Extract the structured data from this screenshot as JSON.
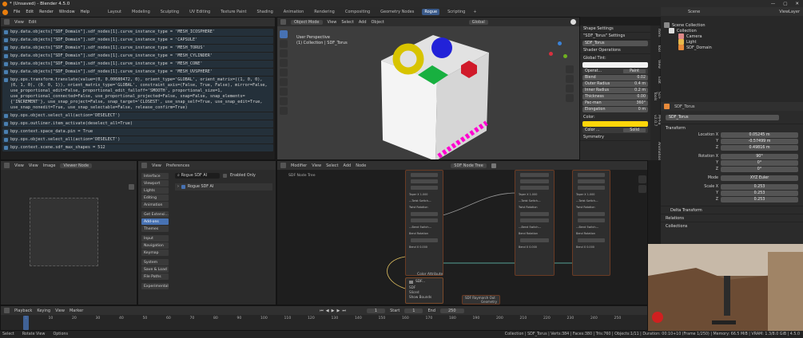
{
  "window": {
    "title": "* (Unsaved) - Blender 4.5.0",
    "controls": [
      "—",
      "▢",
      "✕"
    ]
  },
  "menu": {
    "items": [
      "File",
      "Edit",
      "Render",
      "Window",
      "Help"
    ]
  },
  "workspaces": {
    "tabs": [
      "Layout",
      "Modeling",
      "Sculpting",
      "UV Editing",
      "Texture Paint",
      "Shading",
      "Animation",
      "Rendering",
      "Compositing",
      "Geometry Nodes",
      "Rogue",
      "Scripting"
    ],
    "active": "Rogue",
    "scene": "Scene",
    "view_layer": "ViewLayer"
  },
  "console": {
    "header": [
      "View",
      "Edit"
    ],
    "lines": [
      "bpy.data.objects[\"SDF_Domain\"].sdf_nodes[1].curve_instance_type = 'MESH_ICOSPHERE'",
      "bpy.data.objects[\"SDF_Domain\"].sdf_nodes[1].curve_instance_type = 'CAPSULE'",
      "bpy.data.objects[\"SDF_Domain\"].sdf_nodes[1].curve_instance_type = 'MESH_TORUS'",
      "bpy.data.objects[\"SDF_Domain\"].sdf_nodes[1].curve_instance_type = 'MESH_CYLINDER'",
      "bpy.data.objects[\"SDF_Domain\"].sdf_nodes[1].curve_instance_type = 'MESH_CONE'",
      "bpy.data.objects[\"SDF_Domain\"].sdf_nodes[1].curve_instance_type = 'MESH_UVSPHERE'",
      "bpy.ops.transform.translate(value=(0, 0.00680472, 0), orient_type='GLOBAL', orient_matrix=((1, 0, 0), (0, 1, 0), (0, 0, 1)), orient_matrix_type='GLOBAL', constraint_axis=(False, True, False), mirror=False, use_proportional_edit=False, proportional_edit_falloff='SMOOTH', proportional_size=1, use_proportional_connected=False, use_proportional_projected=False, snap=False, snap_elements={'INCREMENT'}, use_snap_project=False, snap_target='CLOSEST', use_snap_self=True, use_snap_edit=True, use_snap_nonedit=True, use_snap_selectable=False, release_confirm=True)",
      "bpy.ops.object.select_all(action='DESELECT')",
      "bpy.ops.outliner.item_activate(deselect_all=True)",
      "bpy.context.space_data.pin = True",
      "bpy.ops.object.select_all(action='DESELECT')",
      "bpy.context.scene.sdf_max_shapes = 512"
    ]
  },
  "viewport": {
    "mode": "Object Mode",
    "menu": [
      "View",
      "Select",
      "Add",
      "Object"
    ],
    "orientation": "Global",
    "info_line1": "User Perspective",
    "info_line2": "(1) Collection | SDF_Torus",
    "options": "Options",
    "colors": {
      "yellow": "#d8c400",
      "blue": "#2222d8",
      "red": "#d01a2a",
      "green": "#18b040",
      "magenta": "#ff00d0"
    }
  },
  "npanel": {
    "title": "Shape Settings",
    "object": "\"SDF_Torus\" Settings",
    "name": "SDF_Torus",
    "ops_title": "Shader Operations",
    "global_tint": "Global Tint:",
    "operation_label": "Operat...",
    "operation": "Paint",
    "rows": [
      {
        "label": "Blend",
        "value": "0.02"
      },
      {
        "label": "Outer Radius",
        "value": "0.4 m"
      },
      {
        "label": "Inner Radius",
        "value": "0.2 m"
      },
      {
        "label": "Thickness",
        "value": "0.00"
      },
      {
        "label": "Pac-man",
        "value": "360°"
      },
      {
        "label": "Elongation",
        "value": "0 m"
      }
    ],
    "color_label": "Color:",
    "color": "#ffd60a",
    "color_mode_label": "Color ...",
    "color_mode": "Solid",
    "symmetry": "Symmetry"
  },
  "sidetabs": [
    "Item",
    "Tool",
    "View",
    "Edit",
    "SDF Tools",
    "MPFB v2.0.7",
    "Animation"
  ],
  "outliner": {
    "header": "Scene Collection",
    "items": [
      {
        "name": "Collection",
        "level": 1
      },
      {
        "name": "Camera",
        "level": 2
      },
      {
        "name": "Light",
        "level": 2
      },
      {
        "name": "SDF_Domain",
        "level": 2
      }
    ]
  },
  "properties": {
    "object": "SDF_Torus",
    "object_field": "SDF_Torus",
    "transform": "Transform",
    "location_label": "Location X",
    "location": [
      "0.05245 m",
      "-0.57499 m",
      "0.49816 m"
    ],
    "rotation_label": "Rotation X",
    "rotation": [
      "90°",
      "0°",
      "0°"
    ],
    "mode_label": "Mode",
    "mode": "XYZ Euler",
    "scale_label": "Scale X",
    "scale": [
      "0.253",
      "0.253",
      "0.253"
    ],
    "axes": [
      "X",
      "Y",
      "Z"
    ],
    "delta": "Delta Transform",
    "relations": "Relations",
    "collections": "Collections"
  },
  "image_editor": {
    "menu": [
      "View",
      "View",
      "Image"
    ],
    "name": "Viewer Node"
  },
  "prefs": {
    "menu": [
      "View",
      "Preferences"
    ],
    "addon": "Rogue SDF AI",
    "enabled_only": "Enabled Only",
    "addon_item": "Rogue SDF AI",
    "nav": [
      "Interface",
      "Viewport",
      "Lights",
      "Editing",
      "Animation",
      "Get Extensi...",
      "Add-ons",
      "Themes",
      "Input",
      "Navigation",
      "Keymap",
      "System",
      "Save & Load",
      "File Paths",
      "Experimental"
    ],
    "active": "Add-ons"
  },
  "node_editor": {
    "menu": [
      "Modifier",
      "View",
      "Select",
      "Add",
      "Node"
    ],
    "tree": "SDF Node Tree",
    "tree_label": "SDF Node Tree",
    "labels": {
      "taper": "Taper X 1.000",
      "twist_switch": "---Twist Switch---",
      "twist_rot": "Twist Rotation",
      "bend_switch": "---Bend Switch---",
      "bend_rot": "Bend Rotation",
      "bend": "Bend X 0.000"
    },
    "color_attr": "Color Attribute",
    "sdf_node": "SDF...",
    "sdf_socket": "SDF",
    "sliced": "Sliced",
    "show_bounds": "Show Bounds",
    "mode": "Solid",
    "raymarch": "SDF Raymarch Out",
    "geometry": "Geometry"
  },
  "timeline": {
    "menu": [
      "Playback",
      "Keying",
      "View",
      "Marker"
    ],
    "frame": "1",
    "start_label": "Start",
    "start": "1",
    "end_label": "End",
    "end": "250",
    "ticks": [
      "1",
      "10",
      "20",
      "30",
      "40",
      "50",
      "60",
      "70",
      "80",
      "90",
      "100",
      "110",
      "120",
      "130",
      "140",
      "150",
      "160",
      "170",
      "180",
      "190",
      "200",
      "210",
      "220",
      "230",
      "240",
      "250"
    ]
  },
  "status": {
    "left": [
      "Select",
      "Rotate View",
      "Options"
    ],
    "right": "Collection | SDF_Torus | Verts:384 | Faces:380 | Tris:760 | Objects:1/11 | Duration: 00:10+10 (Frame 1/250) | Memory: 66.5 MiB | VRAM: 1.3/8.0 GiB | 4.5.0"
  }
}
